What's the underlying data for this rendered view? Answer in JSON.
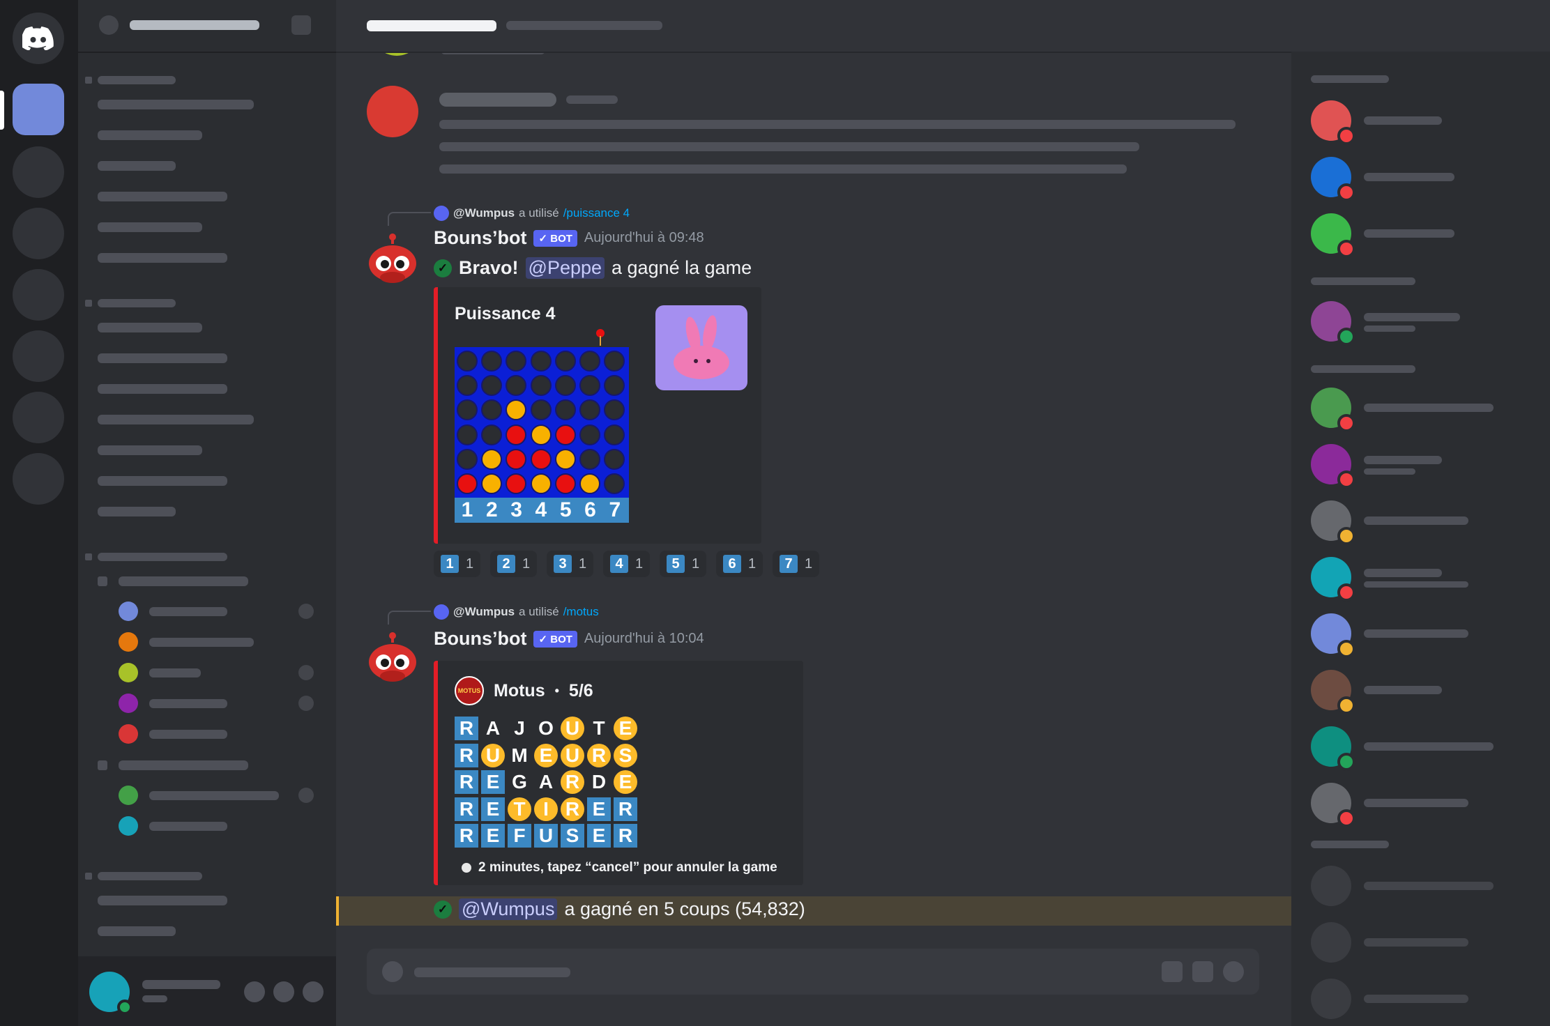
{
  "messages": [
    {
      "reply": {
        "user": "@Wumpus",
        "verb": "a utilisé",
        "command": "/puissance 4"
      },
      "author": "Bouns’bot",
      "badge": "BOT",
      "timestamp": "Aujourd'hui à 09:48",
      "content": {
        "bravo": "Bravo!",
        "mention": "@Peppe",
        "text": "a gagné la game"
      },
      "embed": {
        "title": "Puissance 4",
        "board": [
          [
            "e",
            "e",
            "e",
            "e",
            "e",
            "e",
            "e"
          ],
          [
            "e",
            "e",
            "e",
            "e",
            "e",
            "e",
            "e"
          ],
          [
            "e",
            "e",
            "y",
            "e",
            "e",
            "e",
            "e"
          ],
          [
            "e",
            "e",
            "r",
            "y",
            "r",
            "e",
            "e"
          ],
          [
            "e",
            "y",
            "r",
            "r",
            "y",
            "e",
            "e"
          ],
          [
            "r",
            "y",
            "r",
            "y",
            "r",
            "y",
            "e"
          ]
        ],
        "columns": [
          "1",
          "2",
          "3",
          "4",
          "5",
          "6",
          "7"
        ]
      },
      "reactions": [
        {
          "emoji": "1",
          "count": "1"
        },
        {
          "emoji": "2",
          "count": "1"
        },
        {
          "emoji": "3",
          "count": "1"
        },
        {
          "emoji": "4",
          "count": "1"
        },
        {
          "emoji": "5",
          "count": "1"
        },
        {
          "emoji": "6",
          "count": "1"
        },
        {
          "emoji": "7",
          "count": "1"
        }
      ]
    },
    {
      "reply": {
        "user": "@Wumpus",
        "verb": "a utilisé",
        "command": "/motus"
      },
      "author": "Bouns’bot",
      "badge": "BOT",
      "timestamp": "Aujourd'hui à 10:04",
      "embed": {
        "logo_text": "MOTUS",
        "title": "Motus",
        "separator": "•",
        "progress": "5/6",
        "grid": [
          [
            [
              "R",
              "blue"
            ],
            [
              "A",
              "blank"
            ],
            [
              "J",
              "blank"
            ],
            [
              "O",
              "blank"
            ],
            [
              "U",
              "yellow"
            ],
            [
              "T",
              "blank"
            ],
            [
              "E",
              "yellow"
            ]
          ],
          [
            [
              "R",
              "blue"
            ],
            [
              "U",
              "yellow"
            ],
            [
              "M",
              "blank"
            ],
            [
              "E",
              "yellow"
            ],
            [
              "U",
              "yellow"
            ],
            [
              "R",
              "yellow"
            ],
            [
              "S",
              "yellow"
            ]
          ],
          [
            [
              "R",
              "blue"
            ],
            [
              "E",
              "blue"
            ],
            [
              "G",
              "blank"
            ],
            [
              "A",
              "blank"
            ],
            [
              "R",
              "yellow"
            ],
            [
              "D",
              "blank"
            ],
            [
              "E",
              "yellow"
            ]
          ],
          [
            [
              "R",
              "blue"
            ],
            [
              "E",
              "blue"
            ],
            [
              "T",
              "yellow"
            ],
            [
              "I",
              "yellow"
            ],
            [
              "R",
              "yellow"
            ],
            [
              "E",
              "blue"
            ],
            [
              "R",
              "blue"
            ]
          ],
          [
            [
              "R",
              "blue"
            ],
            [
              "E",
              "blue"
            ],
            [
              "F",
              "blue"
            ],
            [
              "U",
              "blue"
            ],
            [
              "S",
              "blue"
            ],
            [
              "E",
              "blue"
            ],
            [
              "R",
              "blue"
            ]
          ]
        ],
        "footer": "2 minutes, tapez “cancel” pour annuler la game"
      }
    }
  ],
  "highlight": {
    "mention": "@Wumpus",
    "text": "a gagné en 5 coups (54,832)"
  },
  "colors": {
    "accent": "#5865f2",
    "embed_border": "#e31d27",
    "c4_board": "#0b1fd6",
    "c4_red": "#e81010",
    "c4_yellow": "#f8b100",
    "motus_blue": "#3b88c3",
    "motus_yellow": "#fdbb2a"
  },
  "icons": {
    "app": "discord-logo-icon",
    "check": "check-icon",
    "timer": "stopwatch-icon"
  }
}
